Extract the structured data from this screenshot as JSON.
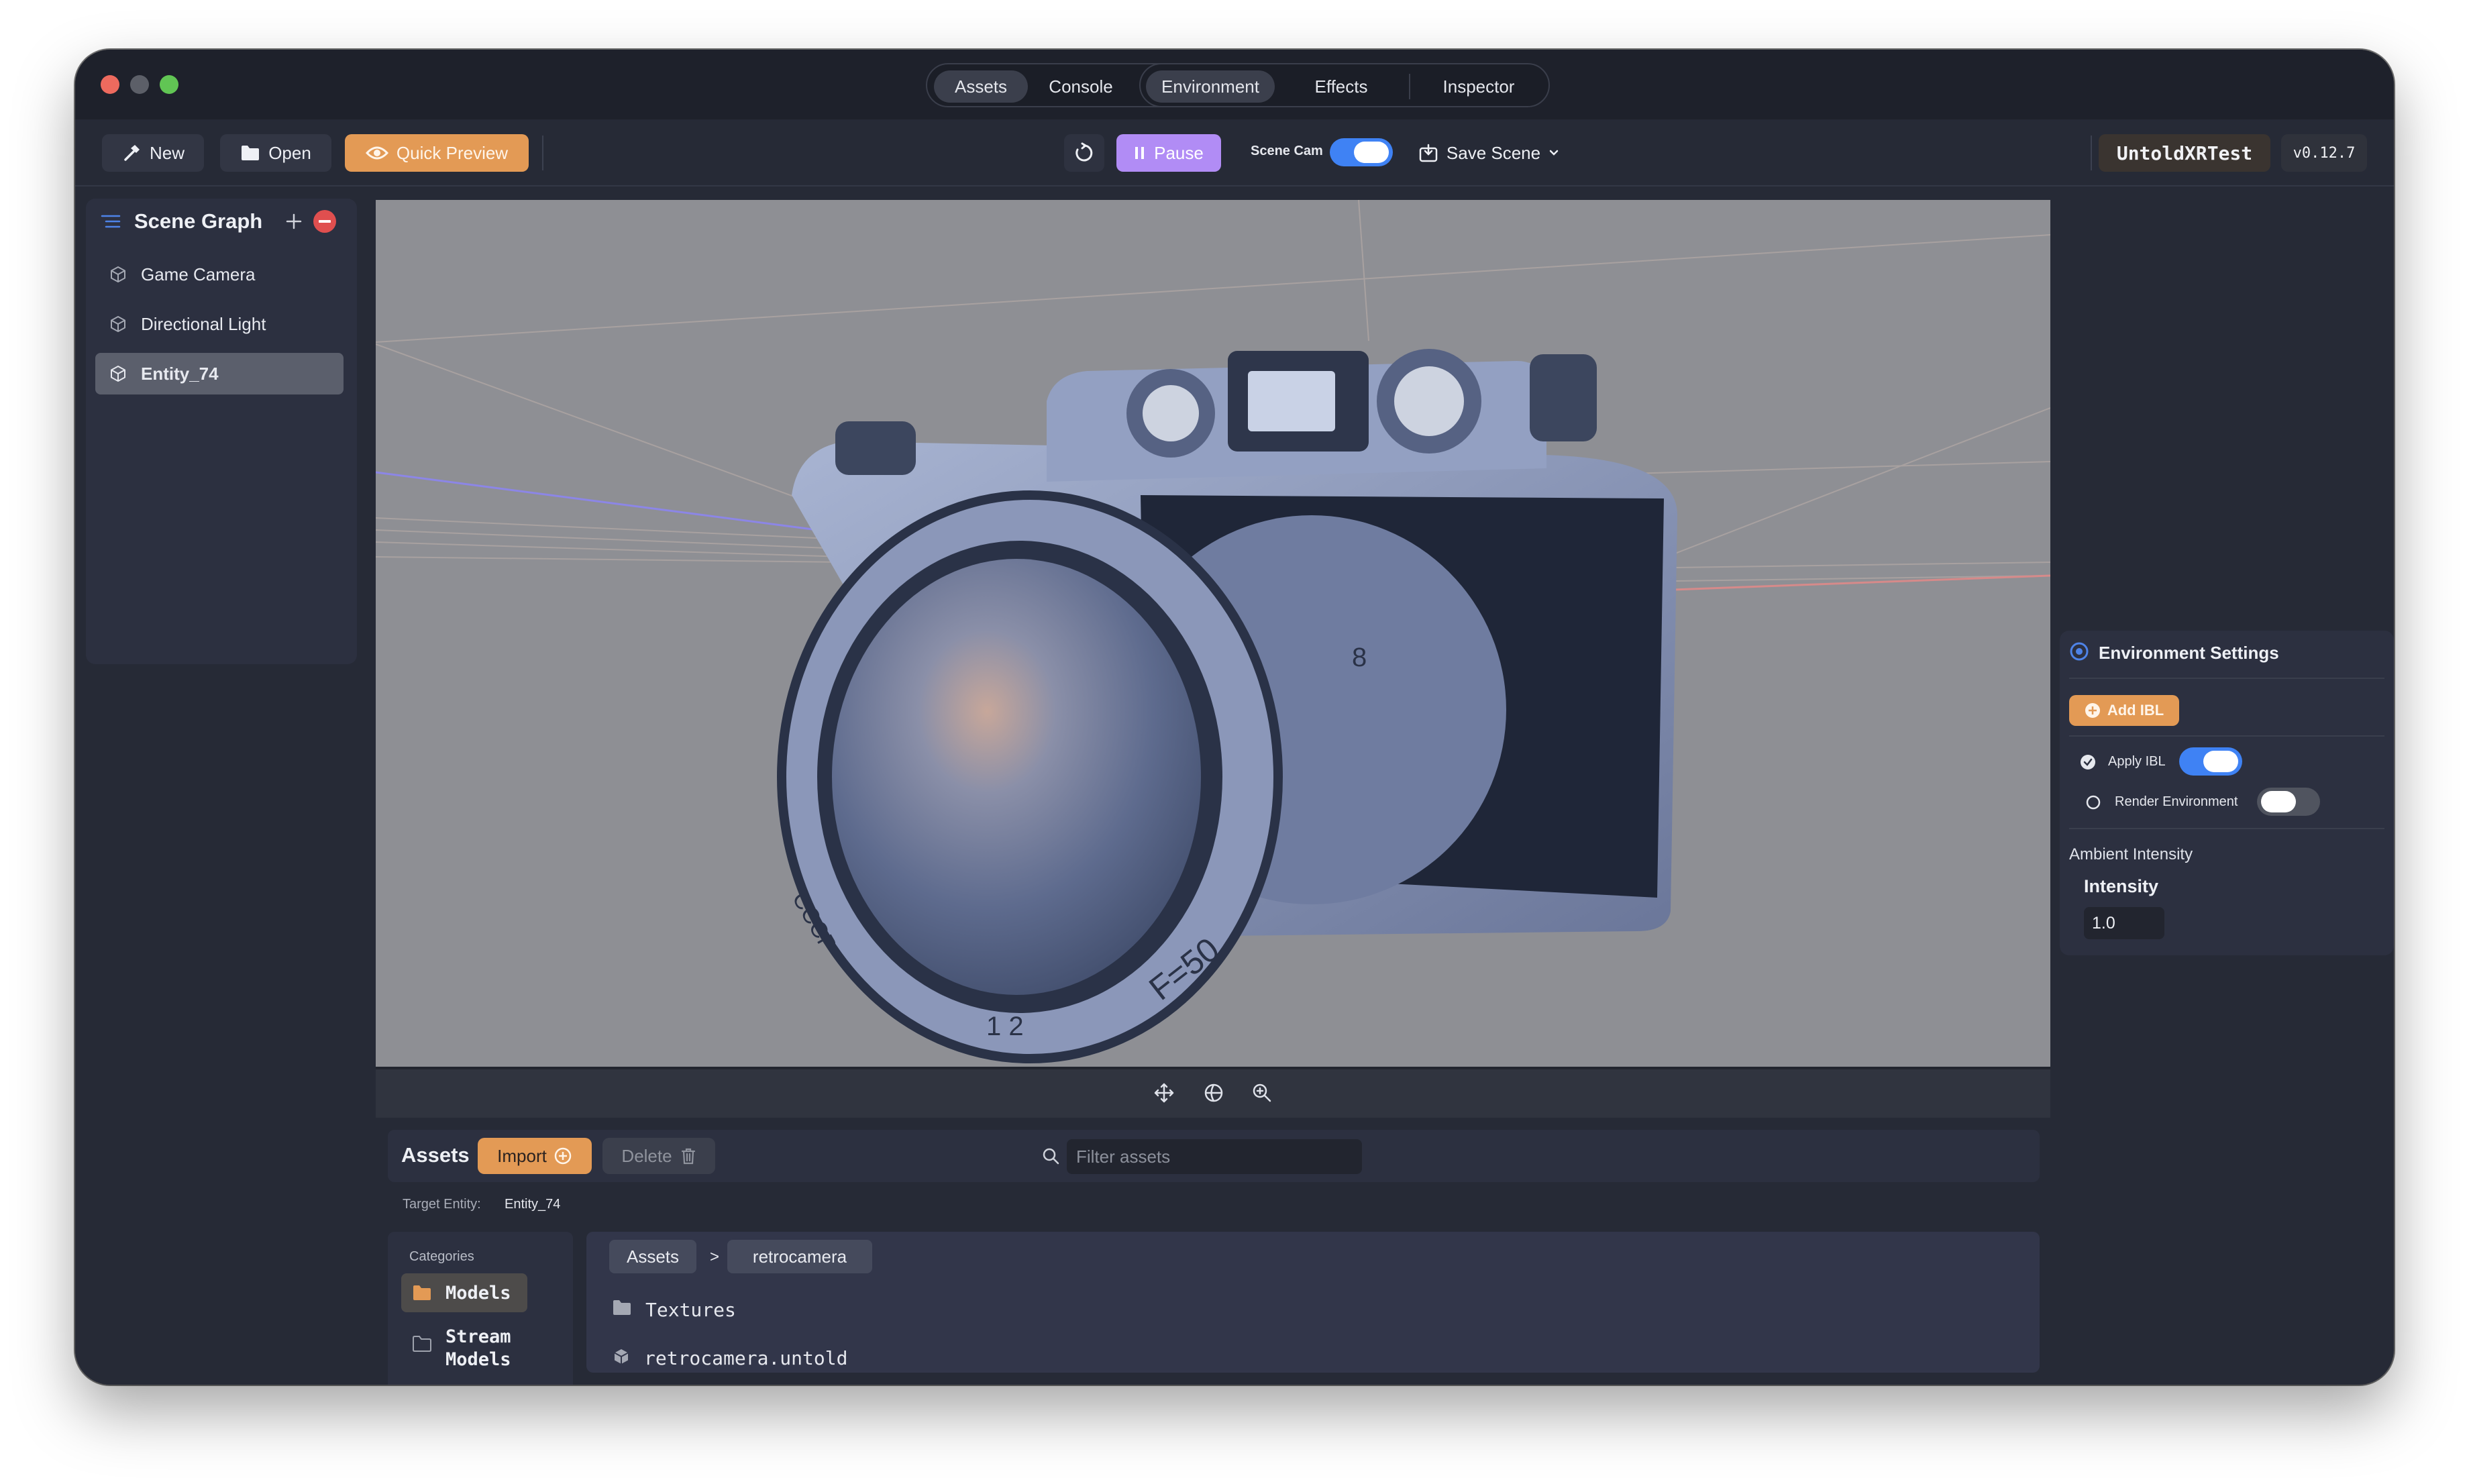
{
  "titlebar": {
    "tabs_left": [
      "Assets",
      "Console"
    ],
    "tabs_right": [
      "Environment",
      "Effects",
      "Inspector"
    ],
    "active_left": "Assets",
    "active_right": "Environment"
  },
  "toolbar": {
    "new_label": "New",
    "open_label": "Open",
    "quick_preview_label": "Quick Preview",
    "pause_label": "Pause",
    "scene_cam_label": "Scene Cam",
    "scene_cam_on": true,
    "save_scene_label": "Save Scene",
    "project_name": "UntoldXRTest",
    "version": "v0.12.7"
  },
  "scene_graph": {
    "title": "Scene Graph",
    "items": [
      {
        "label": "Game Camera"
      },
      {
        "label": "Directional Light"
      },
      {
        "label": "Entity_74",
        "selected": true
      }
    ]
  },
  "viewport": {
    "lens_markings": [
      "F=50",
      "1 2",
      "CCCP",
      "8"
    ]
  },
  "environment": {
    "title": "Environment Settings",
    "add_ibl_label": "Add IBL",
    "apply_ibl_label": "Apply IBL",
    "apply_ibl_on": true,
    "render_env_label": "Render Environment",
    "render_env_on": false,
    "ambient_label": "Ambient Intensity",
    "intensity_label": "Intensity",
    "intensity_value": "1.0"
  },
  "assets": {
    "title": "Assets",
    "import_label": "Import",
    "delete_label": "Delete",
    "filter_placeholder": "Filter assets",
    "target_label": "Target Entity:",
    "target_value": "Entity_74",
    "categories_label": "Categories",
    "categories": [
      "Models",
      "Stream Models"
    ],
    "breadcrumb": [
      "Assets",
      "retrocamera"
    ],
    "breadcrumb_sep": ">",
    "files": [
      {
        "name": "Textures",
        "kind": "folder"
      },
      {
        "name": "retrocamera.untold",
        "kind": "model"
      }
    ]
  },
  "colors": {
    "accent_orange": "#e39a55",
    "accent_purple": "#b18cf5",
    "toggle_blue": "#3f82f4",
    "close_red": "#e04f4f"
  }
}
